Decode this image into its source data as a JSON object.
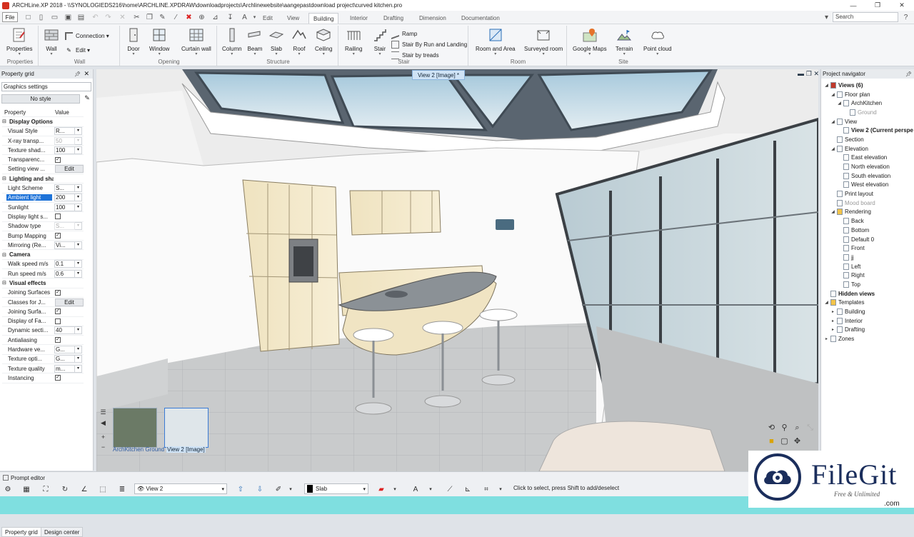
{
  "window": {
    "title": "ARCHLine.XP 2018 - \\\\SYNOLOGIEDS216\\home\\ARCHLINE.XPDRAW\\downloadprojects\\Archlinewebsite\\aangepastdownload project\\curved kitchen.pro",
    "min": "—",
    "max": "❐",
    "close": "✕"
  },
  "menu": {
    "file": "File",
    "tabs": [
      "Edit",
      "View",
      "Building",
      "Interior",
      "Drafting",
      "Dimension",
      "Documentation"
    ],
    "active_tab": "Building",
    "search_placeholder": "Search"
  },
  "ribbon": {
    "properties": {
      "label": "Properties",
      "group": "Properties"
    },
    "wall": {
      "wall": "Wall",
      "connection": "Connection",
      "edit": "Edit",
      "group": "Wall"
    },
    "opening": {
      "door": "Door",
      "window": "Window",
      "curtain": "Curtain wall",
      "group": "Opening"
    },
    "structure": {
      "column": "Column",
      "beam": "Beam",
      "slab": "Slab",
      "roof": "Roof",
      "ceiling": "Ceiling",
      "group": "Structure"
    },
    "stair": {
      "railing": "Railing",
      "stair": "Stair",
      "ramp": "Ramp",
      "run_landing": "Stair By Run and Landing",
      "treads": "Stair by treads",
      "group": "Stair"
    },
    "room": {
      "room_area": "Room and Area",
      "surveyed": "Surveyed room",
      "group": "Room"
    },
    "site": {
      "maps": "Google Maps",
      "terrain": "Terrain",
      "cloud": "Point cloud",
      "group": "Site"
    }
  },
  "property_panel": {
    "title": "Property grid",
    "combo": "Graphics settings",
    "style_button": "No style",
    "header": {
      "name": "Property",
      "value": "Value"
    },
    "rows": [
      {
        "type": "cat",
        "name": "Display Options"
      },
      {
        "type": "combo",
        "name": "Visual Style",
        "value": "R..."
      },
      {
        "type": "combo",
        "name": "X-ray transp...",
        "value": "50",
        "disabled": true
      },
      {
        "type": "combo",
        "name": "Texture shad...",
        "value": "100"
      },
      {
        "type": "check",
        "name": "Transparenc...",
        "checked": true
      },
      {
        "type": "button",
        "name": "Setting view ...",
        "value": "Edit"
      },
      {
        "type": "cat",
        "name": "Lighting and shadow"
      },
      {
        "type": "combo",
        "name": "Light Scheme",
        "value": "S..."
      },
      {
        "type": "combo",
        "name": "Ambient light",
        "value": "200",
        "selected": true
      },
      {
        "type": "combo",
        "name": "Sunlight",
        "value": "100"
      },
      {
        "type": "check",
        "name": "Display light s...",
        "checked": false
      },
      {
        "type": "combo",
        "name": "Shadow type",
        "value": "S...",
        "disabled": true
      },
      {
        "type": "check",
        "name": "Bump Mapping",
        "checked": true
      },
      {
        "type": "combo",
        "name": "Mirroring (Re...",
        "value": "Vi..."
      },
      {
        "type": "cat",
        "name": "Camera"
      },
      {
        "type": "combo",
        "name": "Walk speed m/s",
        "value": "0.1"
      },
      {
        "type": "combo",
        "name": "Run speed m/s",
        "value": "0.6"
      },
      {
        "type": "cat",
        "name": "Visual effects"
      },
      {
        "type": "check",
        "name": "Joining Surfaces",
        "checked": true
      },
      {
        "type": "button",
        "name": "Classes for J...",
        "value": "Edit"
      },
      {
        "type": "check",
        "name": "Joining Surfa...",
        "checked": true
      },
      {
        "type": "check",
        "name": "Display of Fa...",
        "checked": false
      },
      {
        "type": "combo",
        "name": "Dynamic secti...",
        "value": "40"
      },
      {
        "type": "check",
        "name": "Antialiasing",
        "checked": true
      },
      {
        "type": "combo",
        "name": "Hardware ve...",
        "value": "G..."
      },
      {
        "type": "combo",
        "name": "Texture opti...",
        "value": "G..."
      },
      {
        "type": "combo",
        "name": "Texture quality",
        "value": "m..."
      },
      {
        "type": "check",
        "name": "Instancing",
        "checked": true
      }
    ],
    "tabs": [
      "Property grid",
      "Design center"
    ]
  },
  "viewport": {
    "tab": "View 2 [Image] *",
    "thumbnails": [
      "ArchKitchen Ground",
      "View 2 [Image]"
    ]
  },
  "navigator": {
    "title": "Project navigator",
    "tree": [
      {
        "label": "Views (6)",
        "level": 0,
        "bold": true,
        "toggle": "◢"
      },
      {
        "label": "Floor plan",
        "level": 1,
        "toggle": "◢"
      },
      {
        "label": "ArchKitchen",
        "level": 2,
        "toggle": "◢"
      },
      {
        "label": "Ground",
        "level": 3,
        "dim": true
      },
      {
        "label": "View",
        "level": 1,
        "toggle": "◢"
      },
      {
        "label": "View 2 (Current perspe",
        "level": 2,
        "bold": true
      },
      {
        "label": "Section",
        "level": 1
      },
      {
        "label": "Elevation",
        "level": 1,
        "toggle": "◢"
      },
      {
        "label": "East elevation",
        "level": 2
      },
      {
        "label": "North elevation",
        "level": 2
      },
      {
        "label": "South elevation",
        "level": 2
      },
      {
        "label": "West elevation",
        "level": 2
      },
      {
        "label": "Print layout",
        "level": 1
      },
      {
        "label": "Mood board",
        "level": 1,
        "dim": true
      },
      {
        "label": "Rendering",
        "level": 1,
        "toggle": "◢"
      },
      {
        "label": "Back",
        "level": 2
      },
      {
        "label": "Bottom",
        "level": 2
      },
      {
        "label": "Default 0",
        "level": 2
      },
      {
        "label": "Front",
        "level": 2
      },
      {
        "label": "jj",
        "level": 2
      },
      {
        "label": "Left",
        "level": 2
      },
      {
        "label": "Right",
        "level": 2
      },
      {
        "label": "Top",
        "level": 2
      },
      {
        "label": "Hidden views",
        "level": 0,
        "bold": true
      },
      {
        "label": "Templates",
        "level": 0,
        "toggle": "◢"
      },
      {
        "label": "Building",
        "level": 1,
        "toggle": "▸"
      },
      {
        "label": "Interior",
        "level": 1,
        "toggle": "▸"
      },
      {
        "label": "Drafting",
        "level": 1,
        "toggle": "▸"
      },
      {
        "label": "Zones",
        "level": 0,
        "toggle": "▸"
      }
    ]
  },
  "status": {
    "prompt_tab": "Prompt editor",
    "view_combo": "View 2",
    "layer_combo": "Slab",
    "message": "Click to select, press Shift to add/deselect"
  },
  "watermark": {
    "name": "FileGit",
    "tagline": "Free & Unlimited",
    "suffix": ".com"
  }
}
